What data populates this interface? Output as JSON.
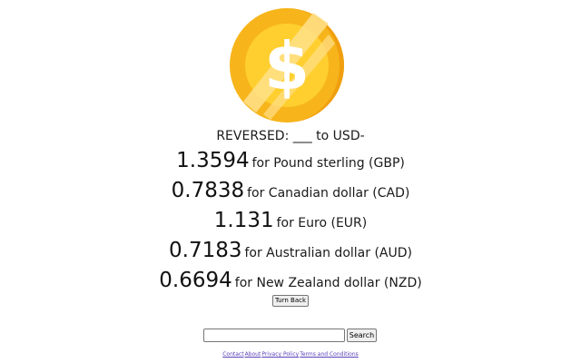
{
  "logo": {
    "icon": "dollar-coin-icon",
    "symbol": "$",
    "colors": {
      "outer": "#f7b51b",
      "outer_shadow": "#f09f0f",
      "inner": "#fecf2f",
      "highlight": "#ffe08a",
      "symbol": "#ffffff"
    }
  },
  "heading": "REVERSED: ___ to USD-",
  "rates": [
    {
      "value": "1.3594",
      "label": "for Pound sterling (GBP)"
    },
    {
      "value": "0.7838",
      "label": "for Canadian dollar (CAD)"
    },
    {
      "value": "1.131",
      "label": "for Euro (EUR)"
    },
    {
      "value": "0.7183",
      "label": "for Australian dollar (AUD)"
    },
    {
      "value": "0.6694",
      "label": "for New Zealand dollar (NZD)"
    }
  ],
  "turn_back_label": "Turn Back",
  "search": {
    "value": "",
    "placeholder": "",
    "button_label": "Search"
  },
  "footer": {
    "links": [
      "Contact",
      "About",
      "Privacy Policy",
      "Terms and Conditions"
    ],
    "link_color": "#5b3fb8"
  }
}
